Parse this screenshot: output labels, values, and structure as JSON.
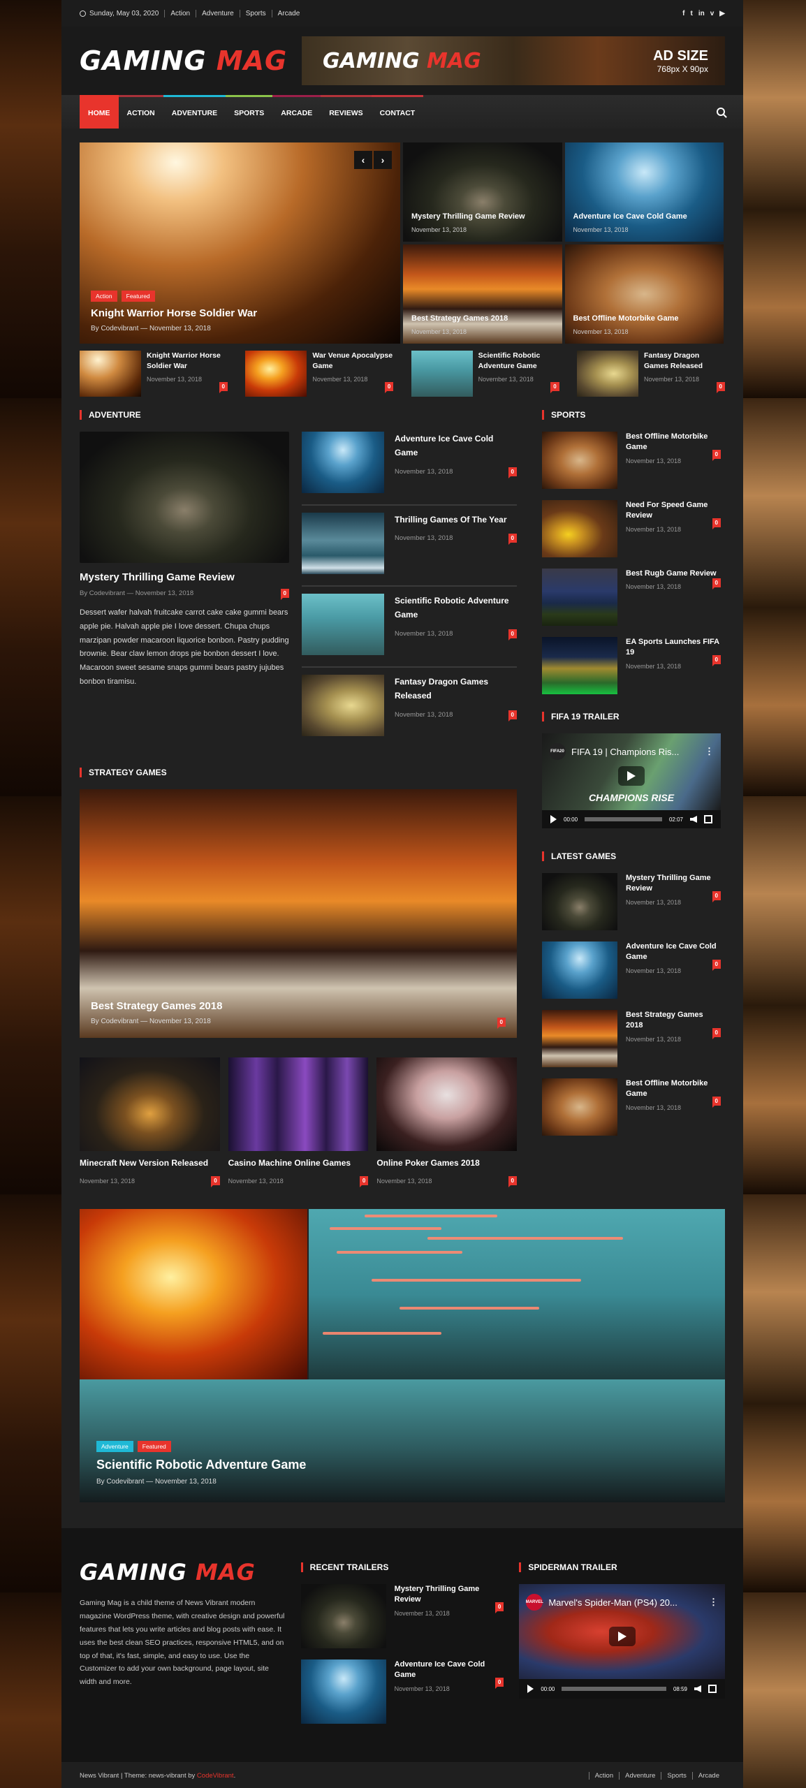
{
  "topbar": {
    "date": "Sunday, May 03, 2020",
    "links": [
      "Action",
      "Adventure",
      "Sports",
      "Arcade"
    ],
    "social": [
      "f",
      "t",
      "in",
      "v",
      "▶"
    ]
  },
  "header": {
    "logo_white": "GAMING",
    "logo_red": "MAG",
    "ad": {
      "logo_white": "GAMING",
      "logo_red": "MAG",
      "title": "AD SIZE",
      "size": "768px X 90px"
    }
  },
  "nav": {
    "items": [
      {
        "label": "HOME",
        "color": "#e8342c"
      },
      {
        "label": "ACTION",
        "color": "#a8323a"
      },
      {
        "label": "ADVENTURE",
        "color": "#1fb9d6"
      },
      {
        "label": "SPORTS",
        "color": "#8bc34a"
      },
      {
        "label": "ARCADE",
        "color": "#9c1f4a"
      },
      {
        "label": "REVIEWS",
        "color": "#b2333a"
      },
      {
        "label": "CONTACT",
        "color": "#c2343a"
      }
    ]
  },
  "hero": {
    "main": {
      "categories": [
        "Action",
        "Featured"
      ],
      "title": "Knight Warrior Horse Soldier War",
      "author": "By Codevibrant",
      "date": "November 13, 2018",
      "prev": "‹",
      "next": "›"
    },
    "tiles": [
      {
        "title": "Mystery Thrilling Game Review",
        "date": "November 13, 2018"
      },
      {
        "title": "Adventure Ice Cave Cold Game",
        "date": "November 13, 2018"
      },
      {
        "title": "Best Strategy Games 2018",
        "date": "November 13, 2018"
      },
      {
        "title": "Best Offline Motorbike Game",
        "date": "November 13, 2018"
      }
    ]
  },
  "small_row": [
    {
      "title": "Knight Warrior Horse Soldier War",
      "date": "November 13, 2018",
      "comments": "0"
    },
    {
      "title": "War Venue Apocalypse Game",
      "date": "November 13, 2018",
      "comments": "0"
    },
    {
      "title": "Scientific Robotic Adventure Game",
      "date": "November 13, 2018",
      "comments": "0"
    },
    {
      "title": "Fantasy Dragon Games Released",
      "date": "November 13, 2018",
      "comments": "0"
    }
  ],
  "adventure": {
    "heading": "ADVENTURE",
    "main": {
      "title": "Mystery Thrilling Game Review",
      "author": "By Codevibrant",
      "date": "November 13, 2018",
      "comments": "0",
      "excerpt": "Dessert wafer halvah fruitcake carrot cake cake gummi bears apple pie. Halvah apple pie I love dessert. Chupa chups marzipan powder macaroon liquorice bonbon. Pastry pudding brownie. Bear claw lemon drops pie bonbon dessert I love. Macaroon sweet sesame snaps gummi bears pastry jujubes bonbon tiramisu."
    },
    "list": [
      {
        "title": "Adventure Ice Cave Cold Game",
        "date": "November 13, 2018",
        "comments": "0"
      },
      {
        "title": "Thrilling Games Of The Year",
        "date": "November 13, 2018",
        "comments": "0"
      },
      {
        "title": "Scientific Robotic Adventure Game",
        "date": "November 13, 2018",
        "comments": "0"
      },
      {
        "title": "Fantasy Dragon Games Released",
        "date": "November 13, 2018",
        "comments": "0"
      }
    ]
  },
  "strategy": {
    "heading": "STRATEGY GAMES",
    "main": {
      "title": "Best Strategy Games 2018",
      "author": "By Codevibrant",
      "date": "November 13, 2018",
      "comments": "0"
    },
    "grid": [
      {
        "title": "Minecraft New Version Released",
        "date": "November 13, 2018",
        "comments": "0"
      },
      {
        "title": "Casino Machine Online Games",
        "date": "November 13, 2018",
        "comments": "0"
      },
      {
        "title": "Online Poker Games 2018",
        "date": "November 13, 2018",
        "comments": "0"
      }
    ]
  },
  "sidebar": {
    "sports": {
      "heading": "SPORTS",
      "items": [
        {
          "title": "Best Offline Motorbike Game",
          "date": "November 13, 2018",
          "comments": "0"
        },
        {
          "title": "Need For Speed Game Review",
          "date": "November 13, 2018",
          "comments": "0"
        },
        {
          "title": "Best Rugb Game Review",
          "date": "November 13, 2018",
          "comments": "0"
        },
        {
          "title": "EA Sports Launches FIFA 19",
          "date": "November 13, 2018",
          "comments": "0"
        }
      ]
    },
    "fifa": {
      "heading": "FIFA 19 TRAILER",
      "video_title": "FIFA 19 | Champions Ris...",
      "channel": "FIFA20",
      "caption": "CHAMPIONS RISE",
      "current": "00:00",
      "duration": "02:07"
    },
    "latest": {
      "heading": "LATEST GAMES",
      "items": [
        {
          "title": "Mystery Thrilling Game Review",
          "date": "November 13, 2018",
          "comments": "0"
        },
        {
          "title": "Adventure Ice Cave Cold Game",
          "date": "November 13, 2018",
          "comments": "0"
        },
        {
          "title": "Best Strategy Games 2018",
          "date": "November 13, 2018",
          "comments": "0"
        },
        {
          "title": "Best Offline Motorbike Game",
          "date": "November 13, 2018",
          "comments": "0"
        }
      ]
    }
  },
  "slider": {
    "categories": [
      "Adventure",
      "Featured"
    ],
    "title": "Scientific Robotic Adventure Game",
    "author": "By Codevibrant",
    "date": "November 13, 2018"
  },
  "footer": {
    "logo_white": "GAMING",
    "logo_red": "MAG",
    "about": "Gaming Mag is a child theme of News Vibrant modern magazine WordPress theme, with creative design and powerful features that lets you write articles and blog posts with ease. It uses the best clean SEO practices, responsive HTML5, and on top of that, it's fast, simple, and easy to use. Use the Customizer to add your own background, page layout, site width and more.",
    "trailers": {
      "heading": "RECENT TRAILERS",
      "items": [
        {
          "title": "Mystery Thrilling Game Review",
          "date": "November 13, 2018",
          "comments": "0"
        },
        {
          "title": "Adventure Ice Cave Cold Game",
          "date": "November 13, 2018",
          "comments": "0"
        }
      ]
    },
    "spiderman": {
      "heading": "SPIDERMAN TRAILER",
      "video_title": "Marvel's Spider-Man (PS4) 20...",
      "channel": "MARVEL",
      "current": "00:00",
      "duration": "08:59"
    }
  },
  "bottombar": {
    "credit_prefix": "News Vibrant | Theme: news-vibrant by",
    "credit_link": "CodeVibrant",
    "credit_suffix": ".",
    "links": [
      "Action",
      "Adventure",
      "Sports",
      "Arcade"
    ]
  }
}
